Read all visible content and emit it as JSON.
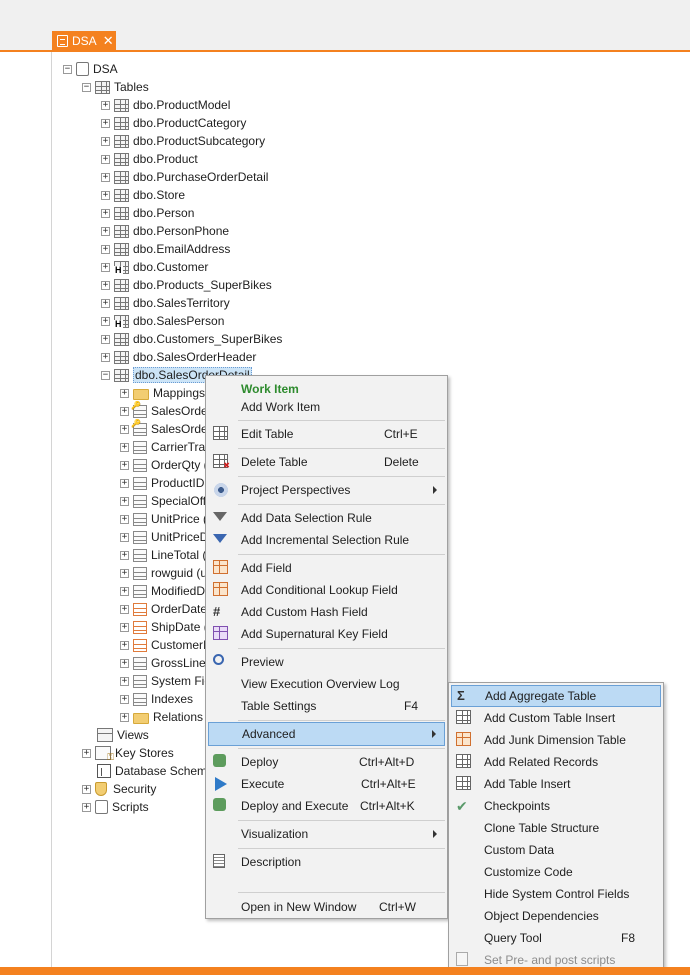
{
  "document_tab": {
    "label": "DSA",
    "close": "✕"
  },
  "tree": {
    "root": "DSA",
    "tables_label": "Tables",
    "tables": [
      "dbo.ProductModel",
      "dbo.ProductCategory",
      "dbo.ProductSubcategory",
      "dbo.Product",
      "dbo.PurchaseOrderDetail",
      "dbo.Store",
      "dbo.Person",
      "dbo.PersonPhone",
      "dbo.EmailAddress",
      "dbo.Customer",
      "dbo.Products_SuperBikes",
      "dbo.SalesTerritory",
      "dbo.SalesPerson",
      "dbo.Customers_SuperBikes",
      "dbo.SalesOrderHeader",
      "dbo.SalesOrderDetail"
    ],
    "selected_table_visible": "dbo.SalesOrderDetail",
    "children": [
      "Mappings",
      "SalesOrde",
      "SalesOrde",
      "CarrierTrac",
      "OrderQty (s",
      "ProductID",
      "SpecialOff",
      "UnitPrice (",
      "UnitPriceD",
      "LineTotal (",
      "rowguid (u",
      "ModifiedDa",
      "OrderDate",
      "ShipDate (",
      "CustomerI",
      "GrossLine",
      "System Fie",
      "Indexes",
      "Relations"
    ],
    "bottom": [
      "Views",
      "Key Stores",
      "Database Schema",
      "Security",
      "Scripts"
    ]
  },
  "context_menu": {
    "items": {
      "work_item_header": "Work Item",
      "add_work_item": "Add Work Item",
      "edit_table": "Edit Table",
      "edit_table_sc": "Ctrl+E",
      "delete_table": "Delete Table",
      "delete_table_sc": "Delete",
      "project_perspectives": "Project Perspectives",
      "add_data_selection_rule": "Add Data Selection Rule",
      "add_incremental_selection_rule": "Add Incremental Selection Rule",
      "add_field": "Add Field",
      "add_conditional_lookup_field": "Add Conditional Lookup Field",
      "add_custom_hash_field": "Add Custom Hash Field",
      "add_supernatural_key_field": "Add Supernatural Key Field",
      "preview": "Preview",
      "view_execution_overview_log": "View Execution Overview Log",
      "table_settings": "Table Settings",
      "table_settings_sc": "F4",
      "advanced": "Advanced",
      "deploy": "Deploy",
      "deploy_sc": "Ctrl+Alt+D",
      "execute": "Execute",
      "execute_sc": "Ctrl+Alt+E",
      "deploy_and_execute": "Deploy and Execute",
      "deploy_and_execute_sc": "Ctrl+Alt+K",
      "visualization": "Visualization",
      "description": "Description",
      "open_in_new_window": "Open in New Window",
      "open_in_new_window_sc": "Ctrl+W"
    }
  },
  "submenu": {
    "add_aggregate_table": "Add Aggregate Table",
    "add_custom_table_insert": "Add Custom Table Insert",
    "add_junk_dimension_table": "Add Junk Dimension Table",
    "add_related_records": "Add Related Records",
    "add_table_insert": "Add Table Insert",
    "checkpoints": "Checkpoints",
    "clone_table_structure": "Clone Table Structure",
    "custom_data": "Custom Data",
    "customize_code": "Customize Code",
    "hide_system_control_fields": "Hide System Control Fields",
    "object_dependencies": "Object Dependencies",
    "query_tool": "Query Tool",
    "query_tool_sc": "F8",
    "set_pre_post_scripts": "Set Pre- and post scripts"
  },
  "colors": {
    "accent": "#f4811f",
    "highlight": "#bcdaf4",
    "header_green": "#2e8b2e"
  }
}
